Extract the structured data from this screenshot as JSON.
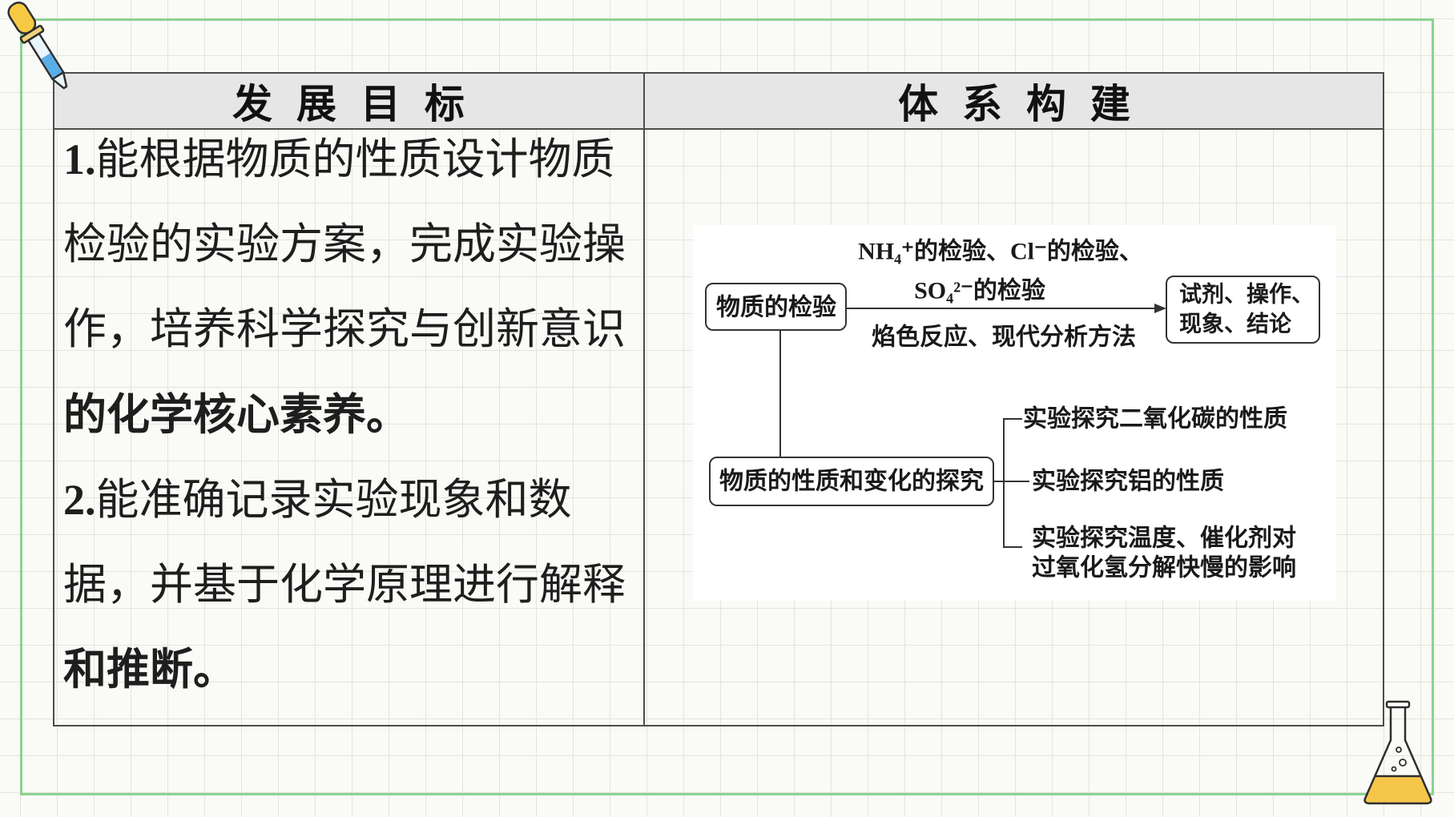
{
  "colors": {
    "frame": "#8bd38f",
    "header_bg": "#e6e6e6",
    "table_border": "#4d4d4d",
    "text": "#1c1c1c",
    "dropper_bulb": "#f6c945",
    "dropper_liquid": "#5aaee8",
    "flask_liquid": "#f6c64a"
  },
  "icons": {
    "top_left": "dropper-icon",
    "bottom_right": "flask-icon"
  },
  "table": {
    "headers": [
      "发 展 目 标",
      "体 系 构 建"
    ]
  },
  "goals": [
    {
      "number": "1.",
      "lines": [
        "能根据物质的性质设计物质",
        "检验的实验方案，完成实验操",
        "作，培养科学探究与创新意识",
        "的化学核心素养。"
      ]
    },
    {
      "number": "2.",
      "lines": [
        "能准确记录实验现象和数",
        "据，并基于化学原理进行解释",
        "和推断。"
      ]
    }
  ],
  "diagram": {
    "detection": "物质的检验",
    "methods_above": [
      "NH₄⁺的检验、Cl⁻的检验、",
      "SO₄²⁻的检验"
    ],
    "methods_below": "焰色反应、现代分析方法",
    "outcome": [
      "试剂、操作、",
      "现象、结论"
    ],
    "exploration": "物质的性质和变化的探究",
    "experiments": [
      {
        "lines": [
          "实验探究二氧化碳的性质"
        ]
      },
      {
        "lines": [
          "实验探究铝的性质"
        ]
      },
      {
        "lines": [
          "实验探究温度、催化剂对",
          "过氧化氢分解快慢的影响"
        ]
      }
    ]
  }
}
